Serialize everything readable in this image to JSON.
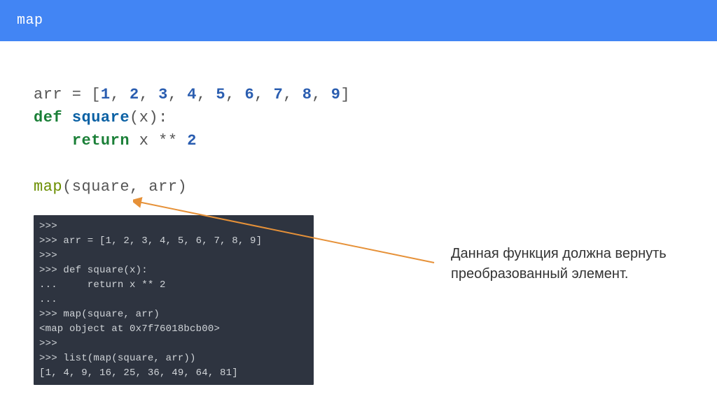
{
  "header": {
    "title": "map"
  },
  "code": {
    "line1_pre": "arr = [",
    "line1_nums": [
      "1",
      "2",
      "3",
      "4",
      "5",
      "6",
      "7",
      "8",
      "9"
    ],
    "line1_post": "]",
    "line2": {
      "kw": "def",
      "name": "square",
      "rest": "(x):"
    },
    "line3": {
      "indent": "    ",
      "kw": "return",
      "rest": " x ** ",
      "num": "2"
    },
    "line5": {
      "call": "map",
      "rest": "(square, arr)"
    }
  },
  "terminal": {
    "text": ">>>\n>>> arr = [1, 2, 3, 4, 5, 6, 7, 8, 9]\n>>>\n>>> def square(x):\n...     return x ** 2\n...\n>>> map(square, arr)\n<map object at 0x7f76018bcb00>\n>>>\n>>> list(map(square, arr))\n[1, 4, 9, 16, 25, 36, 49, 64, 81]"
  },
  "note": {
    "text": "Данная функция должна вернуть преобразованный элемент."
  }
}
